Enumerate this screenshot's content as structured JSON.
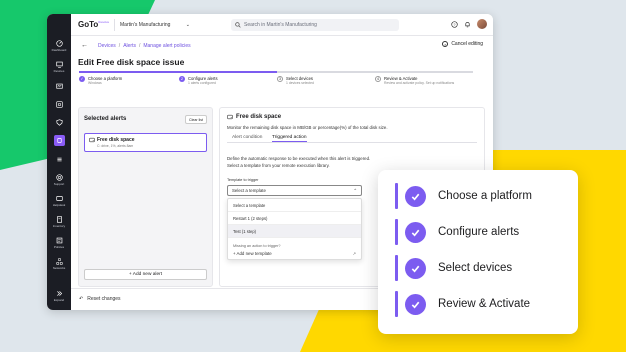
{
  "brand": {
    "logo": "GoTo",
    "logo_sub": "Resolve",
    "accent": "#7c5cf0"
  },
  "topbar": {
    "company": "Martin's Manufacturing",
    "search_placeholder": "Search in Martin's Manufacturing"
  },
  "rail": {
    "items": [
      "Dashboard",
      "Devices",
      "",
      "",
      "",
      "",
      "",
      "Support",
      "Helpdesk",
      "Inventory",
      "Policies",
      "Networks",
      "Expand"
    ]
  },
  "breadcrumb": {
    "items": [
      "Devices",
      "Alerts",
      "Manage alert policies"
    ]
  },
  "cancel_label": "Cancel editing",
  "page_title": "Edit Free disk space issue",
  "steps": [
    {
      "num": "",
      "title": "Choose a platform",
      "sub": "Windows"
    },
    {
      "num": "2",
      "title": "Configure alerts",
      "sub": "1 alerts configured"
    },
    {
      "num": "3",
      "title": "Select devices",
      "sub": "1 devices selected"
    },
    {
      "num": "4",
      "title": "Review & Activate",
      "sub": "Review and activate policy. Set up notifications"
    }
  ],
  "selected_alerts": {
    "title": "Selected alerts",
    "clear_label": "Clear list",
    "card_title": "Free disk space",
    "card_sub": "C: drive, 1%, alerts 8am",
    "add_label": "+ Add new alert"
  },
  "detail": {
    "title": "Free disk space",
    "desc": "Monitor the remaining disk space in MB/GB or percentage(%) of the total disk size.",
    "tabs": [
      "Alert condition",
      "Triggered action"
    ],
    "define_line1": "Define the automatic response to be executed when this alert is triggered.",
    "define_line2": "Select a template from your remote execution library.",
    "template_label": "Template to trigger",
    "select_value": "Select a template",
    "options": [
      "Select a template",
      "Restart 1 (2 steps)",
      "Test (1 step)"
    ],
    "missing_text": "Missing an action to trigger?",
    "add_template": "+ Add new template"
  },
  "footer": {
    "reset_label": "Reset changes"
  },
  "callout": {
    "items": [
      "Choose a platform",
      "Configure alerts",
      "Select devices",
      "Review & Activate"
    ]
  }
}
